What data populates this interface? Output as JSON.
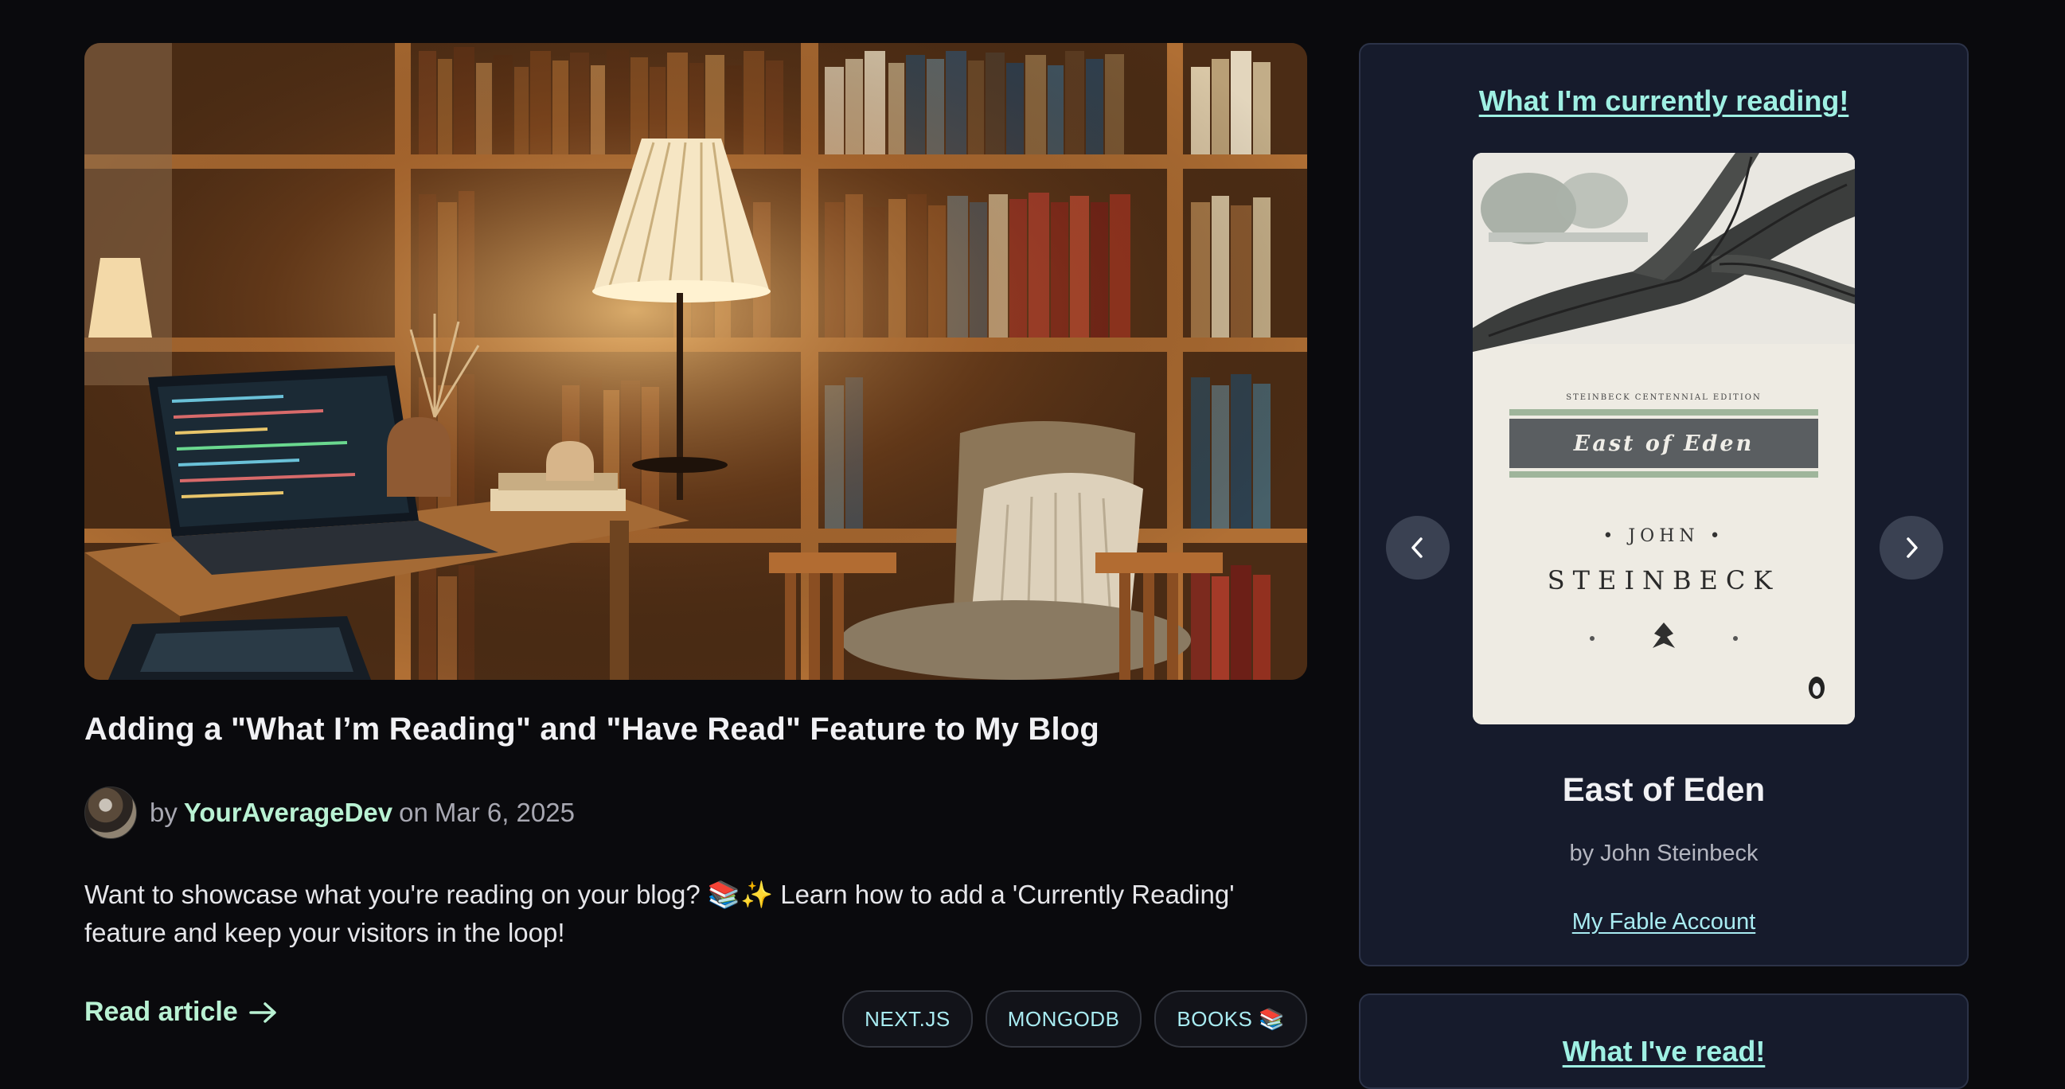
{
  "article": {
    "title": "Adding a \"What I’m Reading\" and \"Have Read\" Feature to My Blog",
    "by_label": "by",
    "author": "YourAverageDev",
    "on_label": "on",
    "date": "Mar 6, 2025",
    "excerpt": "Want to showcase what you're reading on your blog? 📚✨ Learn how to add a 'Currently Reading' feature and keep your visitors in the loop!",
    "read_link": "Read article",
    "read_icon": "arrow-right-icon",
    "tags": [
      "NEXT.JS",
      "MONGODB",
      "BOOKS 📚"
    ]
  },
  "reading": {
    "heading": "What I'm currently reading!",
    "book_title": "East of Eden",
    "book_author": "by John Steinbeck",
    "account_link": "My Fable Account",
    "cover": {
      "edition_line": "STEINBECK CENTENNIAL EDITION",
      "title": "East of Eden",
      "author_first": "• JOHN •",
      "author_last": "STEINBECK"
    },
    "prev_icon": "chevron-left-icon",
    "next_icon": "chevron-right-icon"
  },
  "second_card": {
    "heading": "What I've read!"
  },
  "colors": {
    "background": "#0a0a0d",
    "card": "#161b2c",
    "accent_green": "#b9f2d3",
    "accent_cyan": "#a9ecf2"
  }
}
